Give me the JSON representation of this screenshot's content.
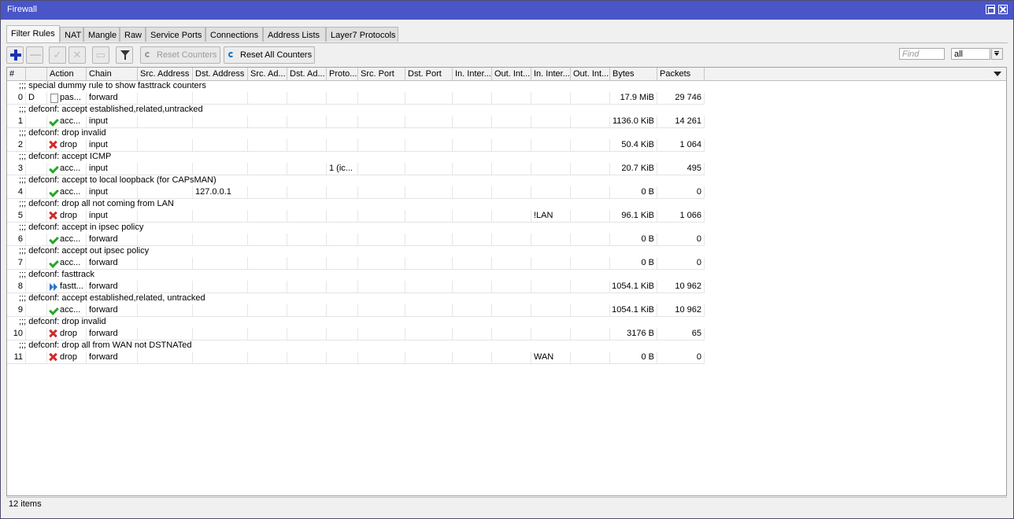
{
  "window": {
    "title": "Firewall"
  },
  "tabs": [
    "Filter Rules",
    "NAT",
    "Mangle",
    "Raw",
    "Service Ports",
    "Connections",
    "Address Lists",
    "Layer7 Protocols"
  ],
  "toolbar": {
    "reset_counters": "Reset Counters",
    "reset_all_counters": "Reset All Counters",
    "find_placeholder": "Find",
    "filter_value": "all"
  },
  "columns": [
    "#",
    "",
    "Action",
    "Chain",
    "Src. Address",
    "Dst. Address",
    "Src. Ad...",
    "Dst. Ad...",
    "Proto...",
    "Src. Port",
    "Dst. Port",
    "In. Inter...",
    "Out. Int...",
    "In. Inter...",
    "Out. Int...",
    "Bytes",
    "Packets"
  ],
  "rows": [
    {
      "comment": ";;; special dummy rule to show fasttrack counters"
    },
    {
      "num": "0",
      "flag": "D",
      "icon": "page",
      "action": "pas...",
      "chain": "forward",
      "bytes": "17.9 MiB",
      "packets": "29 746"
    },
    {
      "comment": ";;; defconf: accept established,related,untracked"
    },
    {
      "num": "1",
      "icon": "check",
      "action": "acc...",
      "chain": "input",
      "bytes": "1136.0 KiB",
      "packets": "14 261"
    },
    {
      "comment": ";;; defconf: drop invalid"
    },
    {
      "num": "2",
      "icon": "cross",
      "action": "drop",
      "chain": "input",
      "bytes": "50.4 KiB",
      "packets": "1 064"
    },
    {
      "comment": ";;; defconf: accept ICMP"
    },
    {
      "num": "3",
      "icon": "check",
      "action": "acc...",
      "chain": "input",
      "proto": "1 (ic...",
      "bytes": "20.7 KiB",
      "packets": "495"
    },
    {
      "comment": ";;; defconf: accept to local loopback (for CAPsMAN)"
    },
    {
      "num": "4",
      "icon": "check",
      "action": "acc...",
      "chain": "input",
      "dst": "127.0.0.1",
      "bytes": "0 B",
      "packets": "0"
    },
    {
      "comment": ";;; defconf: drop all not coming from LAN"
    },
    {
      "num": "5",
      "icon": "cross",
      "action": "drop",
      "chain": "input",
      "in_iface2": "!LAN",
      "bytes": "96.1 KiB",
      "packets": "1 066"
    },
    {
      "comment": ";;; defconf: accept in ipsec policy"
    },
    {
      "num": "6",
      "icon": "check",
      "action": "acc...",
      "chain": "forward",
      "bytes": "0 B",
      "packets": "0"
    },
    {
      "comment": ";;; defconf: accept out ipsec policy"
    },
    {
      "num": "7",
      "icon": "check",
      "action": "acc...",
      "chain": "forward",
      "bytes": "0 B",
      "packets": "0"
    },
    {
      "comment": ";;; defconf: fasttrack"
    },
    {
      "num": "8",
      "icon": "ff",
      "action": "fastt...",
      "chain": "forward",
      "bytes": "1054.1 KiB",
      "packets": "10 962"
    },
    {
      "comment": ";;; defconf: accept established,related, untracked"
    },
    {
      "num": "9",
      "icon": "check",
      "action": "acc...",
      "chain": "forward",
      "bytes": "1054.1 KiB",
      "packets": "10 962"
    },
    {
      "comment": ";;; defconf: drop invalid"
    },
    {
      "num": "10",
      "icon": "cross",
      "action": "drop",
      "chain": "forward",
      "bytes": "3176 B",
      "packets": "65"
    },
    {
      "comment": ";;; defconf: drop all from WAN not DSTNATed"
    },
    {
      "num": "11",
      "icon": "cross",
      "action": "drop",
      "chain": "forward",
      "in_iface2": "WAN",
      "bytes": "0 B",
      "packets": "0"
    }
  ],
  "status": "12 items"
}
